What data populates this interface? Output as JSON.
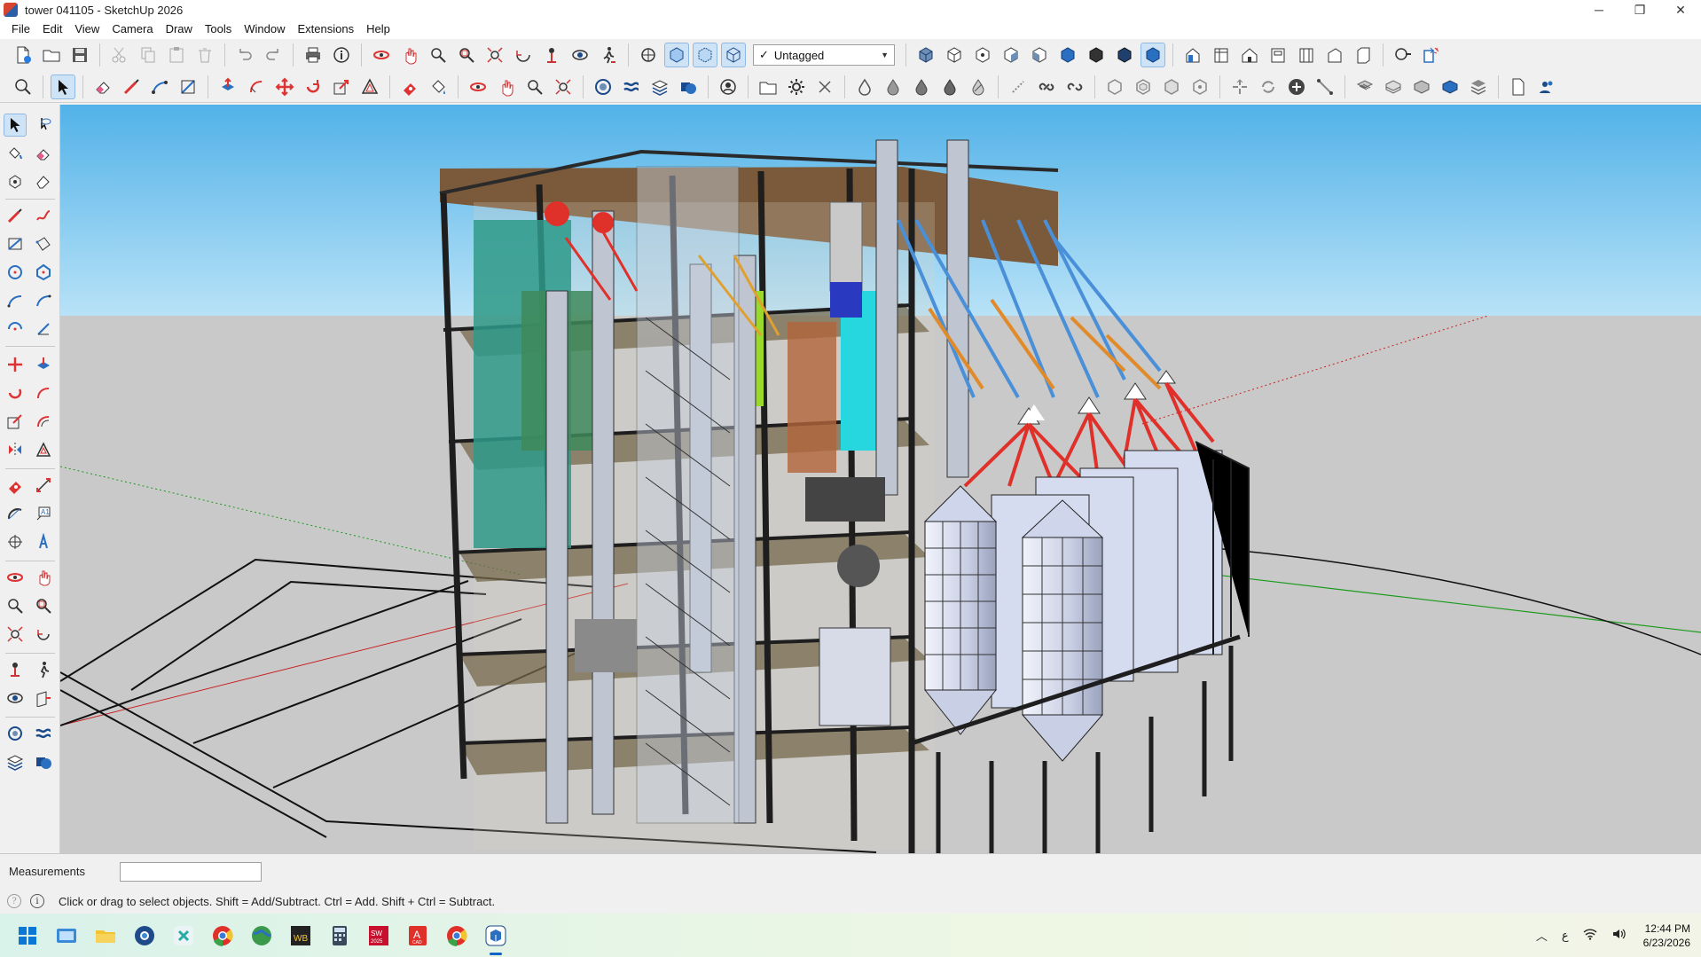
{
  "window": {
    "title": "tower 041105 - SketchUp 2026",
    "minimize_label": "─",
    "restore_label": "❐",
    "close_label": "✕"
  },
  "menu": [
    "File",
    "Edit",
    "View",
    "Camera",
    "Draw",
    "Tools",
    "Window",
    "Extensions",
    "Help"
  ],
  "tag_select": {
    "check": "✓",
    "value": "Untagged"
  },
  "measurements": {
    "label": "Measurements",
    "value": ""
  },
  "status": {
    "text": "Click or drag to select objects. Shift = Add/Subtract. Ctrl = Add. Shift + Ctrl = Subtract."
  },
  "taskbar": {
    "tray_lang": "ﻉ",
    "time": "12:44 PM",
    "date": "6/23/2026",
    "apps": [
      "start",
      "photos",
      "file-explorer",
      "chrome-dev",
      "capcut",
      "chrome",
      "globe",
      "wb",
      "calculator",
      "solidworks-2025",
      "autocad",
      "chrome-2",
      "sketchup"
    ]
  },
  "colors": {
    "sky": "#7ec9ee",
    "ground": "#c9c9c9",
    "accent": "#0a64c8",
    "silo": "#d6dcef",
    "pipe_blue": "#4a90d9",
    "pipe_red": "#e0302a",
    "pipe_orange": "#e08a2a"
  }
}
